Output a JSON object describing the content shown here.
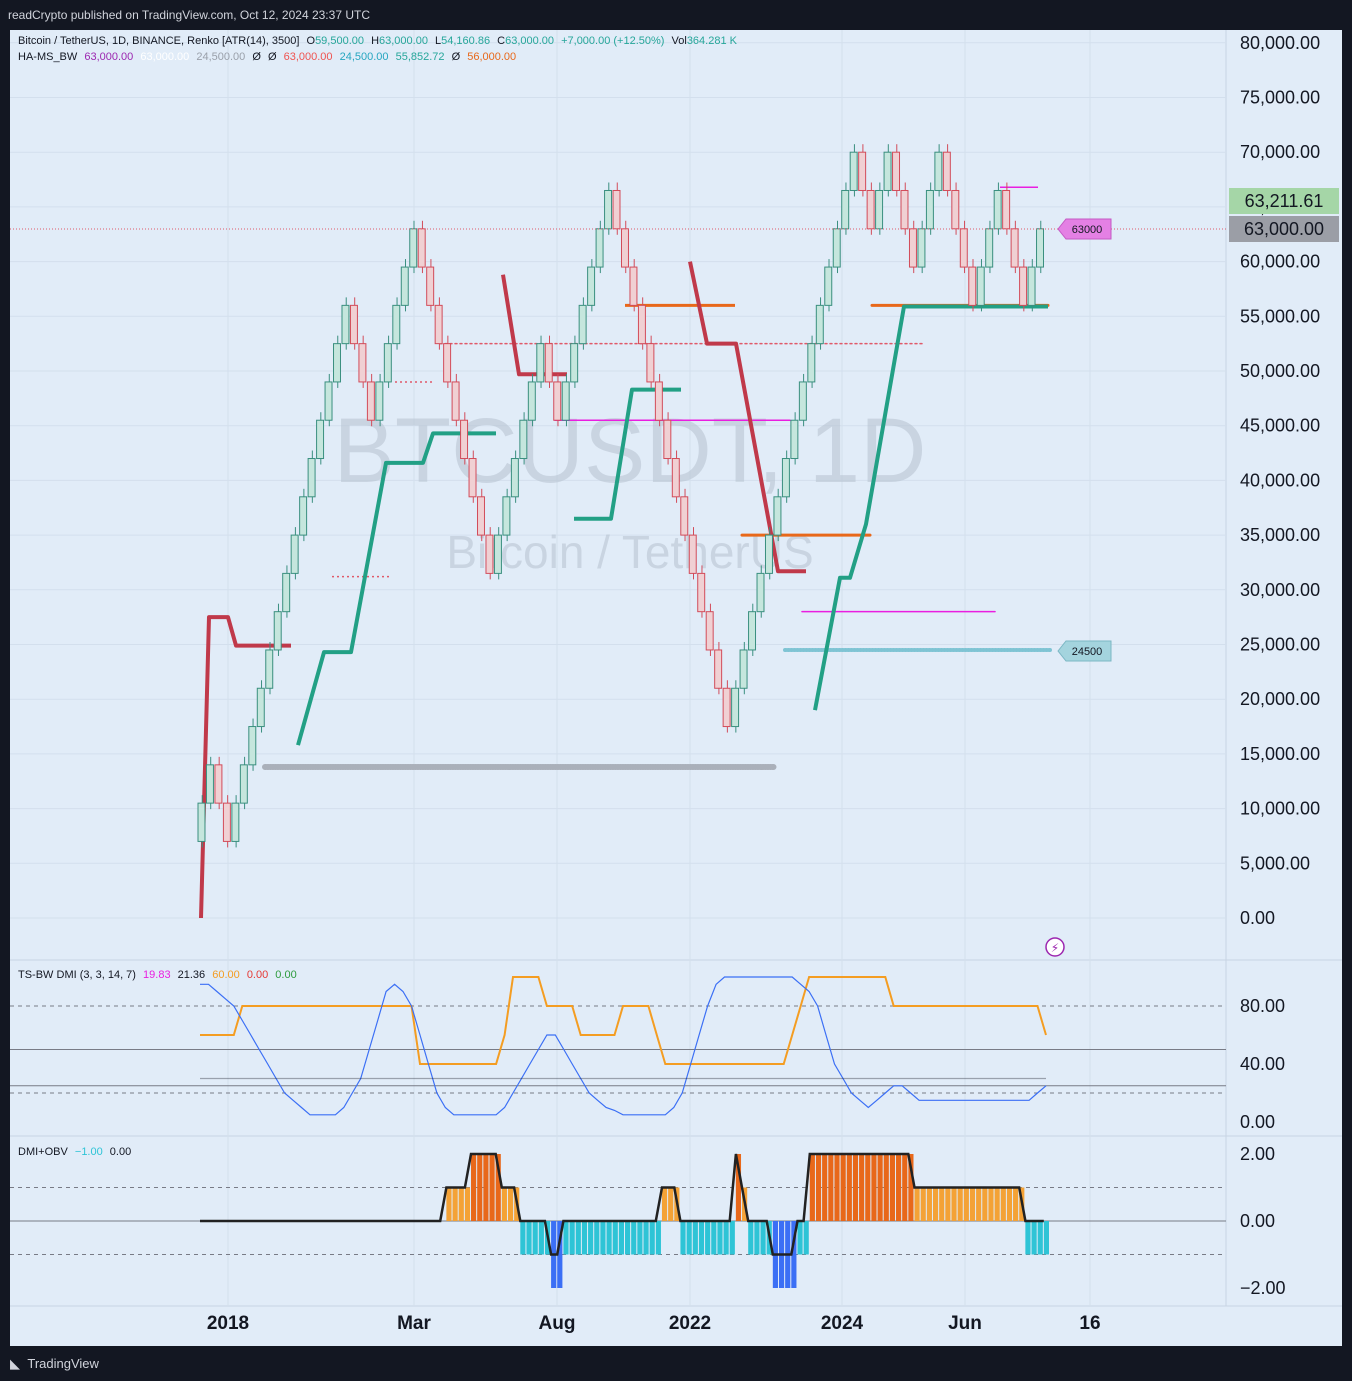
{
  "header": {
    "published": "readCrypto published on TradingView.com, Oct 12, 2024 23:37 UTC"
  },
  "footer": {
    "brand": "TradingView"
  },
  "legend_main": {
    "title": "Bitcoin / TetherUS, 1D, BINANCE, Renko [ATR(14), 3500]",
    "o_label": "O",
    "o": "59,500.00",
    "h_label": "H",
    "h": "63,000.00",
    "l_label": "L",
    "l": "54,160.86",
    "c_label": "C",
    "c": "63,000.00",
    "change": "+7,000.00 (+12.50%)",
    "vol_label": "Vol",
    "vol": "364.281 K"
  },
  "legend_indicator": {
    "name": "HA-MS_BW",
    "v1": "63,000.00",
    "v2": "63,000.00",
    "v3": "24,500.00",
    "v4": "Ø",
    "v5": "Ø",
    "v6": "63,000.00",
    "v7": "24,500.00",
    "v8": "55,852.72",
    "v9": "Ø",
    "v10": "56,000.00"
  },
  "legend_dmi": {
    "name": "TS-BW DMI (3, 3, 14, 7)",
    "v1": "19.83",
    "v2": "21.36",
    "v3": "60.00",
    "v4": "0.00",
    "v5": "0.00"
  },
  "legend_obv": {
    "name": "DMI+OBV",
    "v1": "−1.00",
    "v2": "0.00"
  },
  "watermark": {
    "symbol": "BTCUSDT, 1D",
    "name": "Bitcoin / TetherUS"
  },
  "price_tags": {
    "last": "63,211.61",
    "close": "63,000.00",
    "high_label": "63000",
    "low_label": "24500"
  },
  "colors": {
    "up": "#26a69a",
    "down": "#ef5350",
    "bg": "#e1ecf8",
    "accent_orange": "#f4a236",
    "cyan": "#2ec4d6",
    "blue": "#3b6ff5"
  },
  "chart_data": [
    {
      "type": "renko",
      "title": "Bitcoin / TetherUS, 1D, BINANCE, Renko [ATR(14), 3500]",
      "x_ticks": [
        "2018",
        "Mar",
        "Aug",
        "2022",
        "2024",
        "Jun",
        "16"
      ],
      "y_ticks": [
        "80,000.00",
        "75,000.00",
        "70,000.00",
        "65,000.00",
        "60,000.00",
        "55,000.00",
        "50,000.00",
        "45,000.00",
        "40,000.00",
        "35,000.00",
        "30,000.00",
        "25,000.00",
        "20,000.00",
        "15,000.00",
        "10,000.00",
        "5,000.00",
        "0.00"
      ],
      "ylim": [
        0,
        80000
      ],
      "renko_bricks": [
        7000,
        10500,
        14000,
        10500,
        7000,
        10500,
        14000,
        17500,
        21000,
        24500,
        28000,
        31500,
        35000,
        38500,
        42000,
        45500,
        49000,
        52500,
        56000,
        52500,
        49000,
        45500,
        49000,
        52500,
        56000,
        59500,
        63000,
        59500,
        56000,
        52500,
        49000,
        45500,
        42000,
        38500,
        35000,
        31500,
        35000,
        38500,
        42000,
        45500,
        49000,
        52500,
        49000,
        45500,
        49000,
        52500,
        56000,
        59500,
        63000,
        66500,
        63000,
        59500,
        56000,
        52500,
        49000,
        45500,
        42000,
        38500,
        35000,
        31500,
        28000,
        24500,
        21000,
        17500,
        21000,
        24500,
        28000,
        31500,
        35000,
        38500,
        42000,
        45500,
        49000,
        52500,
        56000,
        59500,
        63000,
        66500,
        70000,
        66500,
        63000,
        66500,
        70000,
        66500,
        63000,
        59500,
        63000,
        66500,
        70000,
        66500,
        63000,
        59500,
        56000,
        59500,
        63000,
        66500,
        63000,
        59500,
        56000,
        59500,
        63000
      ],
      "levels": [
        {
          "value": 63000,
          "style": "dotted"
        },
        {
          "value": 56000,
          "style": "solid"
        },
        {
          "value": 52500,
          "style": "dashed"
        },
        {
          "value": 45500,
          "style": "solid"
        },
        {
          "value": 35000,
          "style": "solid"
        },
        {
          "value": 28000,
          "style": "solid"
        },
        {
          "value": 24500,
          "style": "dotted"
        },
        {
          "value": 13800,
          "style": "dotted"
        }
      ]
    },
    {
      "type": "line",
      "title": "TS-BW DMI (3, 3, 14, 7)",
      "y_ticks": [
        "80.00",
        "40.00",
        "0.00"
      ],
      "ylim": [
        0,
        100
      ],
      "series": [
        {
          "values": [
            60,
            60,
            60,
            60,
            60,
            80,
            80,
            80,
            80,
            80,
            80,
            80,
            80,
            80,
            80,
            80,
            80,
            80,
            80,
            80,
            80,
            80,
            80,
            80,
            80,
            80,
            40,
            40,
            40,
            40,
            40,
            40,
            40,
            40,
            40,
            40,
            60,
            100,
            100,
            100,
            100,
            80,
            80,
            80,
            80,
            60,
            60,
            60,
            60,
            60,
            80,
            80,
            80,
            80,
            60,
            40,
            40,
            40,
            40,
            40,
            40,
            40,
            40,
            40,
            40,
            40,
            40,
            40,
            40,
            40,
            60,
            80,
            100,
            100,
            100,
            100,
            100,
            100,
            100,
            100,
            100,
            100,
            80,
            80,
            80,
            80,
            80,
            80,
            80,
            80,
            80,
            80,
            80,
            80,
            80,
            80,
            80,
            80,
            80,
            80,
            60
          ]
        },
        {
          "values": [
            95,
            95,
            90,
            85,
            80,
            70,
            60,
            50,
            40,
            30,
            20,
            15,
            10,
            5,
            5,
            5,
            5,
            10,
            20,
            30,
            50,
            70,
            90,
            95,
            90,
            80,
            60,
            40,
            20,
            10,
            5,
            5,
            5,
            5,
            5,
            5,
            10,
            20,
            30,
            40,
            50,
            60,
            60,
            50,
            40,
            30,
            20,
            15,
            10,
            8,
            5,
            5,
            5,
            5,
            5,
            5,
            10,
            20,
            40,
            60,
            80,
            95,
            100,
            100,
            100,
            100,
            100,
            100,
            100,
            100,
            100,
            95,
            90,
            80,
            60,
            40,
            30,
            20,
            15,
            10,
            15,
            20,
            25,
            25,
            20,
            15,
            15,
            15,
            15,
            15,
            15,
            15,
            15,
            15,
            15,
            15,
            15,
            15,
            15,
            20,
            25
          ]
        },
        {
          "values": [
            30,
            30,
            30,
            30,
            30,
            30,
            30,
            30,
            30,
            30,
            30,
            30,
            30,
            30,
            30,
            30,
            30,
            30,
            30,
            30,
            30,
            30,
            30,
            30,
            30,
            30,
            30,
            30,
            30,
            30,
            30,
            30,
            30,
            30,
            30,
            30,
            30,
            30,
            30,
            30,
            30,
            30,
            30,
            30,
            30,
            30,
            30,
            30,
            30,
            30,
            30,
            30,
            30,
            30,
            30,
            30,
            30,
            30,
            30,
            30,
            30,
            30,
            30,
            30,
            30,
            30,
            30,
            30,
            30,
            30,
            30,
            30,
            30,
            30,
            30,
            30,
            30,
            30,
            30,
            30,
            30,
            30,
            30,
            30,
            30,
            30,
            30,
            30,
            30,
            30,
            30,
            30,
            30,
            30,
            30,
            30,
            30,
            30,
            30,
            30,
            30
          ]
        }
      ]
    },
    {
      "type": "bar",
      "title": "DMI+OBV",
      "y_ticks": [
        "2.00",
        "0.00",
        "−2.00"
      ],
      "ylim": [
        -2.2,
        2.2
      ],
      "values": [
        0,
        0,
        0,
        0,
        0,
        0,
        0,
        0,
        0,
        0,
        0,
        0,
        0,
        0,
        0,
        0,
        0,
        0,
        0,
        0,
        0,
        0,
        0,
        0,
        0,
        0,
        0,
        0,
        0,
        0,
        0,
        0,
        0,
        0,
        0,
        0,
        0,
        0,
        0,
        0,
        1,
        1,
        1,
        1,
        2,
        2,
        2,
        2,
        2,
        1,
        1,
        1,
        -1,
        -1,
        -1,
        -1,
        -1,
        -2,
        -2,
        -1,
        -1,
        -1,
        -1,
        -1,
        -1,
        -1,
        -1,
        -1,
        -1,
        -1,
        -1,
        -1,
        -1,
        -1,
        -1,
        1,
        1,
        1,
        -1,
        -1,
        -1,
        -1,
        -1,
        -1,
        -1,
        -1,
        -1,
        2,
        1,
        -1,
        -1,
        -1,
        -1,
        -2,
        -2,
        -2,
        -2,
        -1,
        -1,
        2,
        2,
        2,
        2,
        2,
        2,
        2,
        2,
        2,
        2,
        2,
        2,
        2,
        2,
        2,
        2,
        2,
        1,
        1,
        1,
        1,
        1,
        1,
        1,
        1,
        1,
        1,
        1,
        1,
        1,
        1,
        1,
        1,
        1,
        1,
        -1,
        -1,
        -1,
        -1
      ]
    }
  ]
}
